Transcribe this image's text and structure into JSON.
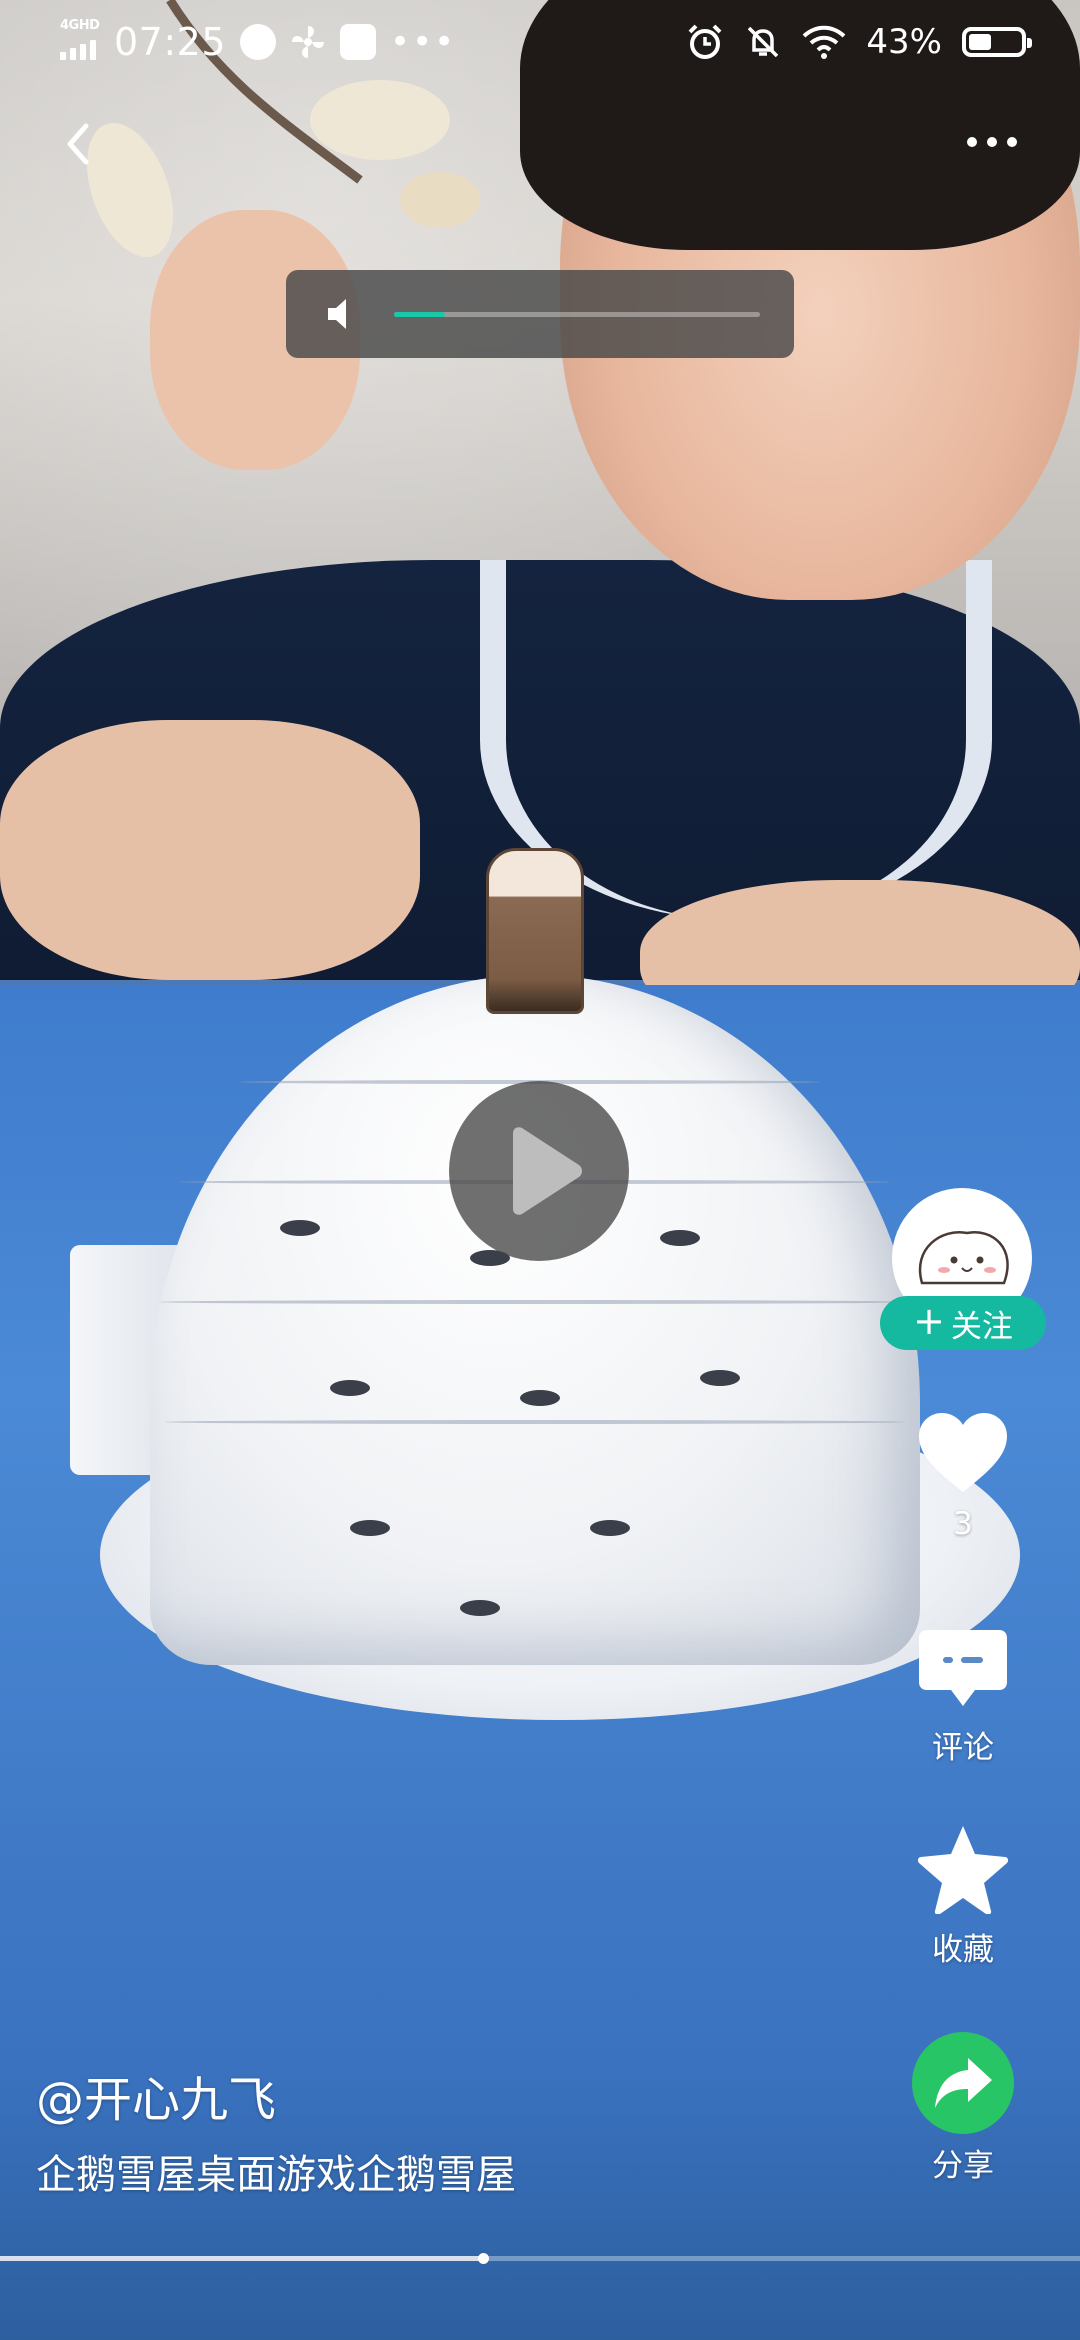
{
  "status_bar": {
    "network": "4GHD",
    "time": "07:25",
    "battery_percent": "43%",
    "battery_level": 0.43,
    "icons": [
      "signal-icon",
      "speed-icon",
      "fan-icon",
      "message-icon",
      "more-dots-icon",
      "alarm-icon",
      "mute-icon",
      "wifi-icon",
      "battery-icon"
    ]
  },
  "top_bar": {
    "back_icon": "back-chevron-icon",
    "more_icon": "more-icon"
  },
  "volume": {
    "icon": "speaker-icon",
    "level": 0.14
  },
  "player": {
    "play_icon": "play-icon",
    "progress": 0.447
  },
  "rail": {
    "follow_label": "关注",
    "like_count": "3",
    "comment_label": "评论",
    "favorite_label": "收藏",
    "share_label": "分享"
  },
  "caption": {
    "author": "@开心九飞",
    "title": "企鹅雪屋桌面游戏企鹅雪屋"
  },
  "colors": {
    "accent_teal": "#14b9a0",
    "share_green": "#28c566",
    "volume_level": "#19c8a8"
  }
}
